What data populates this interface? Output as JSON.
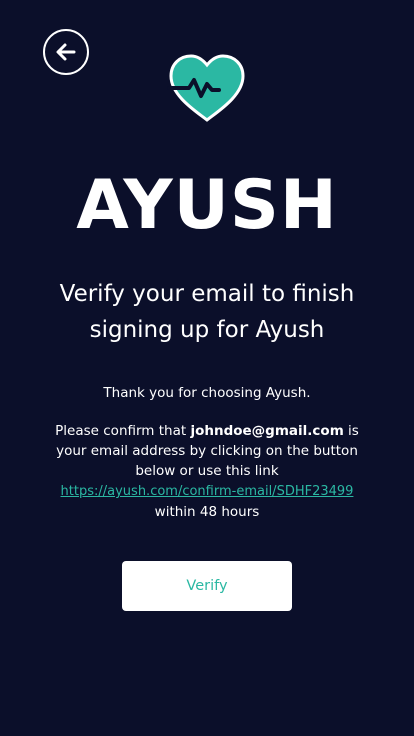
{
  "header": {
    "back_icon": "arrow-left-icon",
    "logo_icon": "heart-pulse-icon"
  },
  "brand": {
    "name": "AYUSH"
  },
  "heading": {
    "text": "Verify your email to finish signing up for Ayush"
  },
  "message": {
    "thanks": "Thank you for choosing Ayush.",
    "confirm_prefix": "Please confirm that ",
    "email": "johndoe@gmail.com",
    "confirm_suffix": " is your email address by clicking on the button below or use this link",
    "link": "https://ayush.com/confirm-email/SDHF23499",
    "deadline": "within 48 hours"
  },
  "actions": {
    "verify_label": "Verify"
  },
  "colors": {
    "background": "#0b0f2a",
    "accent": "#2bb8a3",
    "text": "#ffffff"
  }
}
